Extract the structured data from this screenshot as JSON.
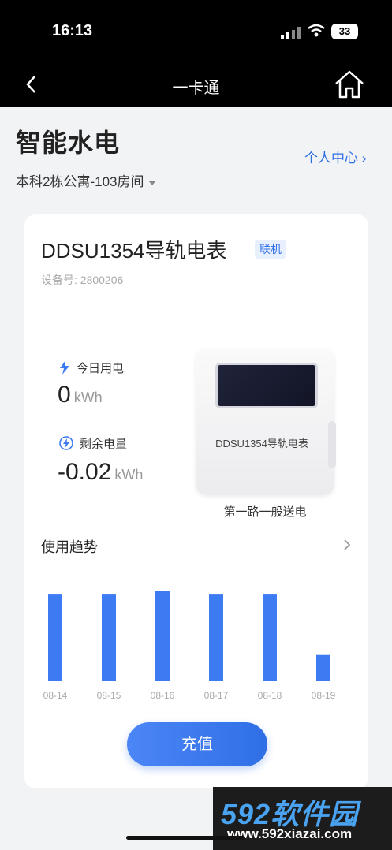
{
  "status": {
    "time": "16:13",
    "battery": "33"
  },
  "nav": {
    "title": "一卡通"
  },
  "header": {
    "title": "智能水电",
    "profile_link": "个人中心 ›",
    "room": "本科2栋公寓-103房间"
  },
  "device": {
    "name": "DDSU1354导轨电表",
    "status_badge": "联机",
    "id_label": "设备号: 2800206",
    "today_label": "今日用电",
    "today_value": "0",
    "today_unit": "kWh",
    "remain_label": "剩余电量",
    "remain_value": "-0.02",
    "remain_unit": "kWh",
    "meter_label": "DDSU1354导轨电表",
    "meter_caption": "第一路一般送电"
  },
  "trend": {
    "title": "使用趋势"
  },
  "chart_data": {
    "type": "bar",
    "categories": [
      "08-14",
      "08-15",
      "08-16",
      "08-17",
      "08-18",
      "08-19"
    ],
    "values": [
      1.0,
      1.0,
      1.03,
      1.0,
      1.0,
      0.3
    ],
    "ylim": [
      0,
      1.1
    ],
    "grid": false,
    "bar_color": "#3d7bf2"
  },
  "actions": {
    "recharge": "充值"
  },
  "watermark": {
    "logo": "592软件园",
    "url": "www.592xiazai.com"
  },
  "colors": {
    "accent": "#2f6fe6"
  }
}
